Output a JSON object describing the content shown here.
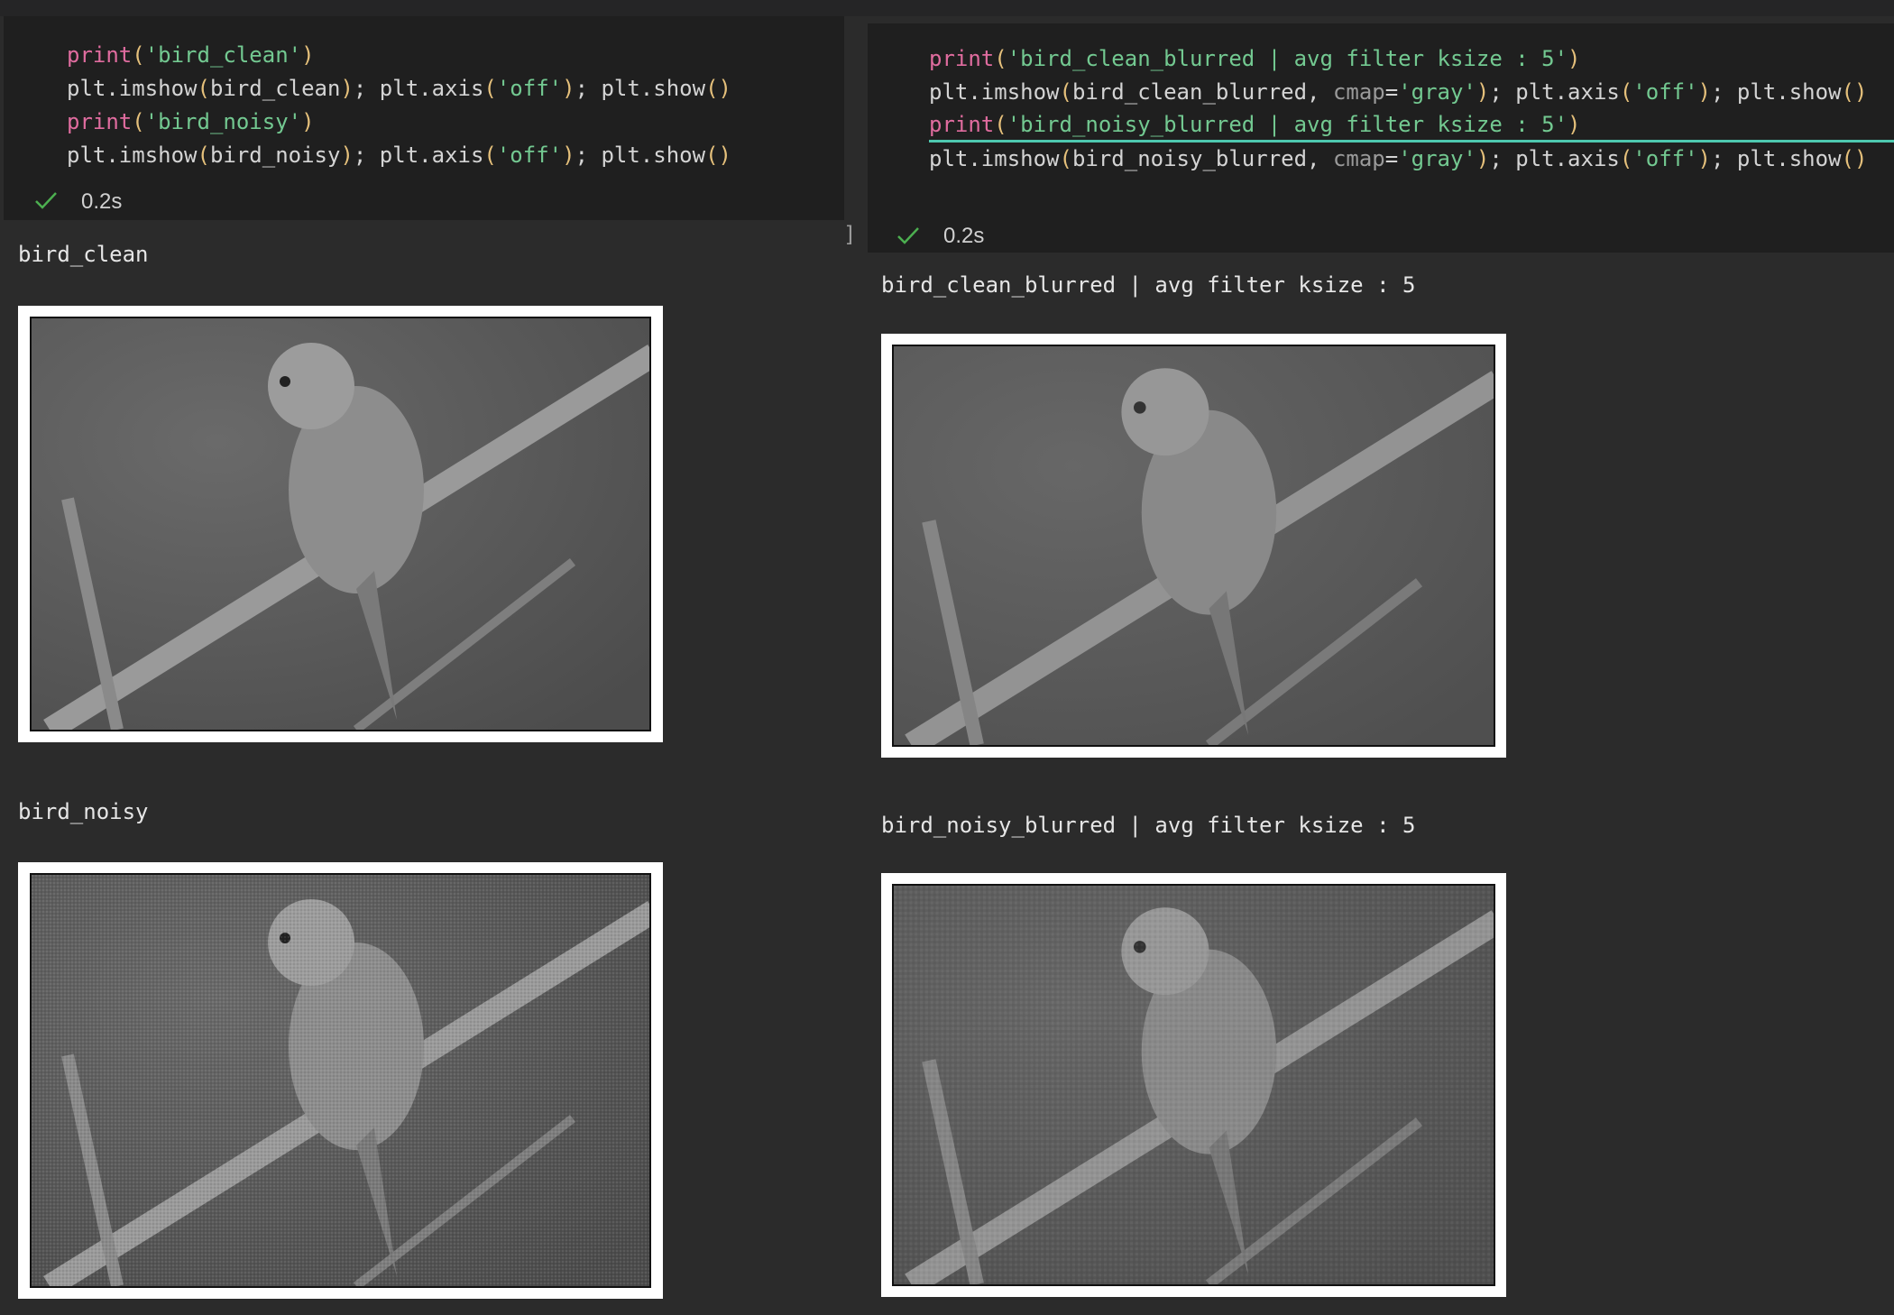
{
  "left_cell": {
    "lines": [
      {
        "fn": "print",
        "open": "(",
        "arg": "'bird_clean'",
        "close": ")"
      },
      {
        "plain": "plt.imshow",
        "open": "(",
        "arg": "bird_clean",
        "close": ")",
        "rest1": "; plt.axis",
        "rest_open": "(",
        "rest_arg": "'off'",
        "rest_close": ")",
        "rest2": "; plt.show",
        "end": "()"
      },
      {
        "fn": "print",
        "open": "(",
        "arg": "'bird_noisy'",
        "close": ")"
      },
      {
        "plain": "plt.imshow",
        "open": "(",
        "arg": "bird_noisy",
        "close": ")",
        "rest1": "; plt.axis",
        "rest_open": "(",
        "rest_arg": "'off'",
        "rest_close": ")",
        "rest2": "; plt.show",
        "end": "()"
      }
    ],
    "time": "0.2s"
  },
  "right_cell": {
    "lines": [
      {
        "fn": "print",
        "open": "(",
        "arg": "'bird_clean_blurred | avg filter ksize : 5'",
        "close": ")"
      },
      {
        "plain": "plt.imshow",
        "open": "(",
        "arg": "bird_clean_blurred, ",
        "kwarg": "cmap",
        "eq": "=",
        "kval": "'gray'",
        "close": ")",
        "rest1": "; plt.axis",
        "rest_open": "(",
        "rest_arg": "'off'",
        "rest_close": ")",
        "rest2": "; plt.show",
        "end": "()"
      },
      {
        "fn": "print",
        "open": "(",
        "arg": "'bird_noisy_blurred | avg filter ksize : 5'",
        "close": ")"
      },
      {
        "plain": "plt.imshow",
        "open": "(",
        "arg": "bird_noisy_blurred, ",
        "kwarg": "cmap",
        "eq": "=",
        "kval": "'gray'",
        "close": ")",
        "rest1": "; plt.axis",
        "rest_open": "(",
        "rest_arg": "'off'",
        "rest_close": ")",
        "rest2": "; plt.show",
        "end": "()"
      }
    ],
    "time": "0.2s",
    "bracket": "]"
  },
  "outputs": {
    "clean_label": "bird_clean",
    "noisy_label": "bird_noisy",
    "clean_blurred_label": "bird_clean_blurred | avg filter ksize : 5",
    "noisy_blurred_label": "bird_noisy_blurred | avg filter ksize : 5"
  },
  "colors": {
    "background": "#2b2b2b",
    "cell_background": "#1f1f1f",
    "keyword": "#e06c9f",
    "string": "#73c991",
    "paren": "#e5c07b",
    "success_check": "#4caf50"
  },
  "icons": {
    "status": "check-icon",
    "image": "bird-on-branch-grayscale"
  }
}
